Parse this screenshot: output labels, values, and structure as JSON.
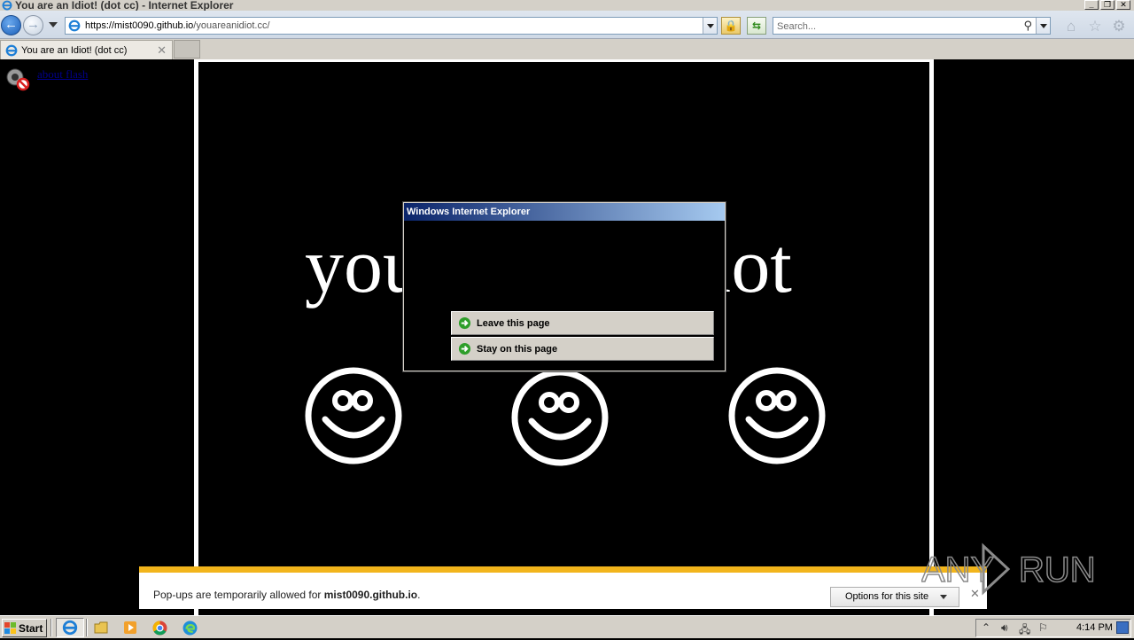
{
  "window": {
    "title": "You are an Idiot! (dot cc) - Internet Explorer",
    "buttons": [
      "_",
      "❐",
      "✕"
    ]
  },
  "navbar": {
    "url_host": "https://mist0090.github.io",
    "url_path": "/youareanidiot.cc/",
    "search_placeholder": "Search..."
  },
  "tab": {
    "label": "You are an Idiot! (dot cc)"
  },
  "page": {
    "flash_link": "about flash",
    "headline": "you are an idiot",
    "smiley_count": 3
  },
  "dialog": {
    "title": "Windows Internet Explorer",
    "leave_label": "Leave this page",
    "stay_label": "Stay on this page"
  },
  "notification": {
    "prefix": "Pop-ups are temporarily allowed for ",
    "site": "mist0090.github.io",
    "suffix": ".",
    "options_label": "Options for this site"
  },
  "watermark": {
    "text": "ANY RUN"
  },
  "taskbar": {
    "start_label": "Start",
    "clock": "4:14 PM",
    "apps": [
      "internet-explorer",
      "file-explorer",
      "media-player",
      "chrome",
      "edge"
    ]
  },
  "colors": {
    "accent_bar": "#f2b51c",
    "dialog_title_start": "#0a246a",
    "dialog_title_end": "#a6caf0",
    "page_background": "#000000"
  }
}
